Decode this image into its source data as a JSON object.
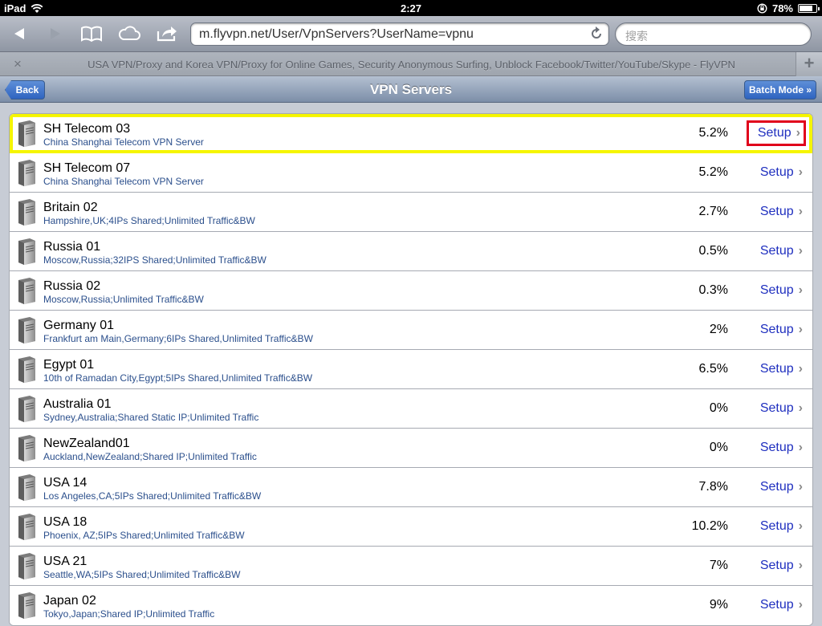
{
  "status": {
    "device": "iPad",
    "time": "2:27",
    "battery": "78%",
    "battery_level": 0.78
  },
  "browser": {
    "url": "m.flyvpn.net/User/VpnServers?UserName=vpnu",
    "search_placeholder": "搜索",
    "tab_title": "USA VPN/Proxy and Korea VPN/Proxy for Online Games, Security Anonymous Surfing, Unblock Facebook/Twitter/YouTube/Skype - FlyVPN",
    "tab_close": "×",
    "tab_add": "+"
  },
  "nav": {
    "back_label": "Back",
    "title": "VPN Servers",
    "batch_label": "Batch Mode »"
  },
  "setup_label": "Setup",
  "servers": [
    {
      "name": "SH Telecom 03",
      "desc": "China Shanghai Telecom VPN Server",
      "load": "5.2%"
    },
    {
      "name": "SH Telecom 07",
      "desc": "China Shanghai Telecom VPN Server",
      "load": "5.2%"
    },
    {
      "name": "Britain 02",
      "desc": "Hampshire,UK;4IPs Shared;Unlimited Traffic&BW",
      "load": "2.7%"
    },
    {
      "name": "Russia 01",
      "desc": "Moscow,Russia;32IPS Shared;Unlimited Traffic&BW",
      "load": "0.5%"
    },
    {
      "name": "Russia 02",
      "desc": "Moscow,Russia;Unlimited Traffic&BW",
      "load": "0.3%"
    },
    {
      "name": "Germany 01",
      "desc": "Frankfurt am Main,Germany;6IPs Shared,Unlimited Traffic&BW",
      "load": "2%"
    },
    {
      "name": "Egypt 01",
      "desc": "10th of Ramadan City,Egypt;5IPs Shared,Unlimited Traffic&BW",
      "load": "6.5%"
    },
    {
      "name": "Australia 01",
      "desc": "Sydney,Australia;Shared Static IP;Unlimited Traffic",
      "load": "0%"
    },
    {
      "name": "NewZealand01",
      "desc": "Auckland,NewZealand;Shared IP;Unlimited Traffic",
      "load": "0%"
    },
    {
      "name": "USA 14",
      "desc": "Los Angeles,CA;5IPs Shared;Unlimited Traffic&BW",
      "load": "7.8%"
    },
    {
      "name": "USA 18",
      "desc": "Phoenix, AZ;5IPs Shared;Unlimited Traffic&BW",
      "load": "10.2%"
    },
    {
      "name": "USA 21",
      "desc": "Seattle,WA;5IPs Shared;Unlimited Traffic&BW",
      "load": "7%"
    },
    {
      "name": "Japan 02",
      "desc": "Tokyo,Japan;Shared IP;Unlimited Traffic",
      "load": "9%"
    }
  ]
}
